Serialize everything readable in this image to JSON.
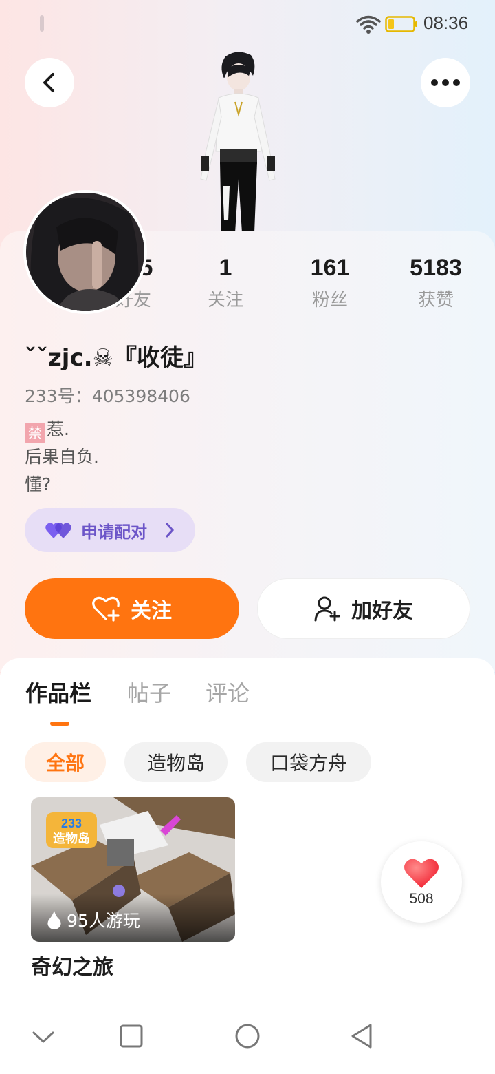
{
  "status_bar": {
    "time": "08:36"
  },
  "stats": [
    {
      "value": "135",
      "label": "好友"
    },
    {
      "value": "1",
      "label": "关注"
    },
    {
      "value": "161",
      "label": "粉丝"
    },
    {
      "value": "5183",
      "label": "获赞"
    }
  ],
  "profile": {
    "nickname": "ˇˇzjc.☠『收徒』",
    "uid": "233号：405398406",
    "bio_badge": "禁",
    "bio_lines": [
      "惹.",
      "后果自负.",
      "懂?"
    ]
  },
  "pair_button": {
    "label": "申请配对"
  },
  "actions": {
    "follow_label": "关注",
    "add_friend_label": "加好友"
  },
  "tabs": [
    {
      "label": "作品栏",
      "active": true
    },
    {
      "label": "帖子",
      "active": false
    },
    {
      "label": "评论",
      "active": false
    }
  ],
  "filters": [
    {
      "label": "全部",
      "active": true
    },
    {
      "label": "造物岛",
      "active": false
    },
    {
      "label": "口袋方舟",
      "active": false
    }
  ],
  "game": {
    "logo_top": "233",
    "logo_bottom": "造物岛",
    "plays": "95人游玩",
    "title": "奇幻之旅"
  },
  "like": {
    "count": "508"
  },
  "colors": {
    "accent": "#ff7410",
    "pair_bg": "#e7def6",
    "pair_text": "#6c55c8"
  },
  "icons": [
    "back-icon",
    "more-icon",
    "heart-plus-icon",
    "user-plus-icon",
    "pair-hearts-icon",
    "fire-icon",
    "heart-icon"
  ]
}
